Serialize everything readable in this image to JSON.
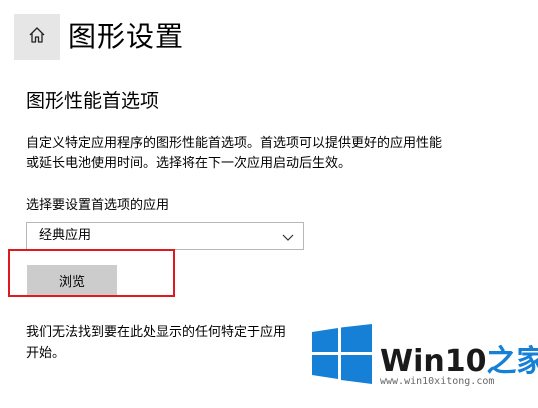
{
  "header": {
    "home_icon": "home-icon",
    "title": "图形设置"
  },
  "main": {
    "section_title": "图形性能首选项",
    "description_lines": [
      "自定义特定应用程序的图形性能首选项。首选项可以提供更好的应用性能",
      "或延长电池使用时间。选择将在下一次应用启动后生效。"
    ],
    "choose_label": "选择要设置首选项的应用",
    "app_type_dropdown": {
      "selected": "经典应用",
      "icon": "chevron-down-icon"
    },
    "browse_button": "浏览",
    "notice_lines": [
      "我们无法找到要在此处显示的任何特定于应用",
      "开始。"
    ]
  },
  "annotation": {
    "highlight_color": "#e0191f"
  },
  "watermark": {
    "brand_main": "Win10",
    "brand_accent": "之家",
    "url": "www.win10xitong.com",
    "logo_color": "#1680d6"
  }
}
